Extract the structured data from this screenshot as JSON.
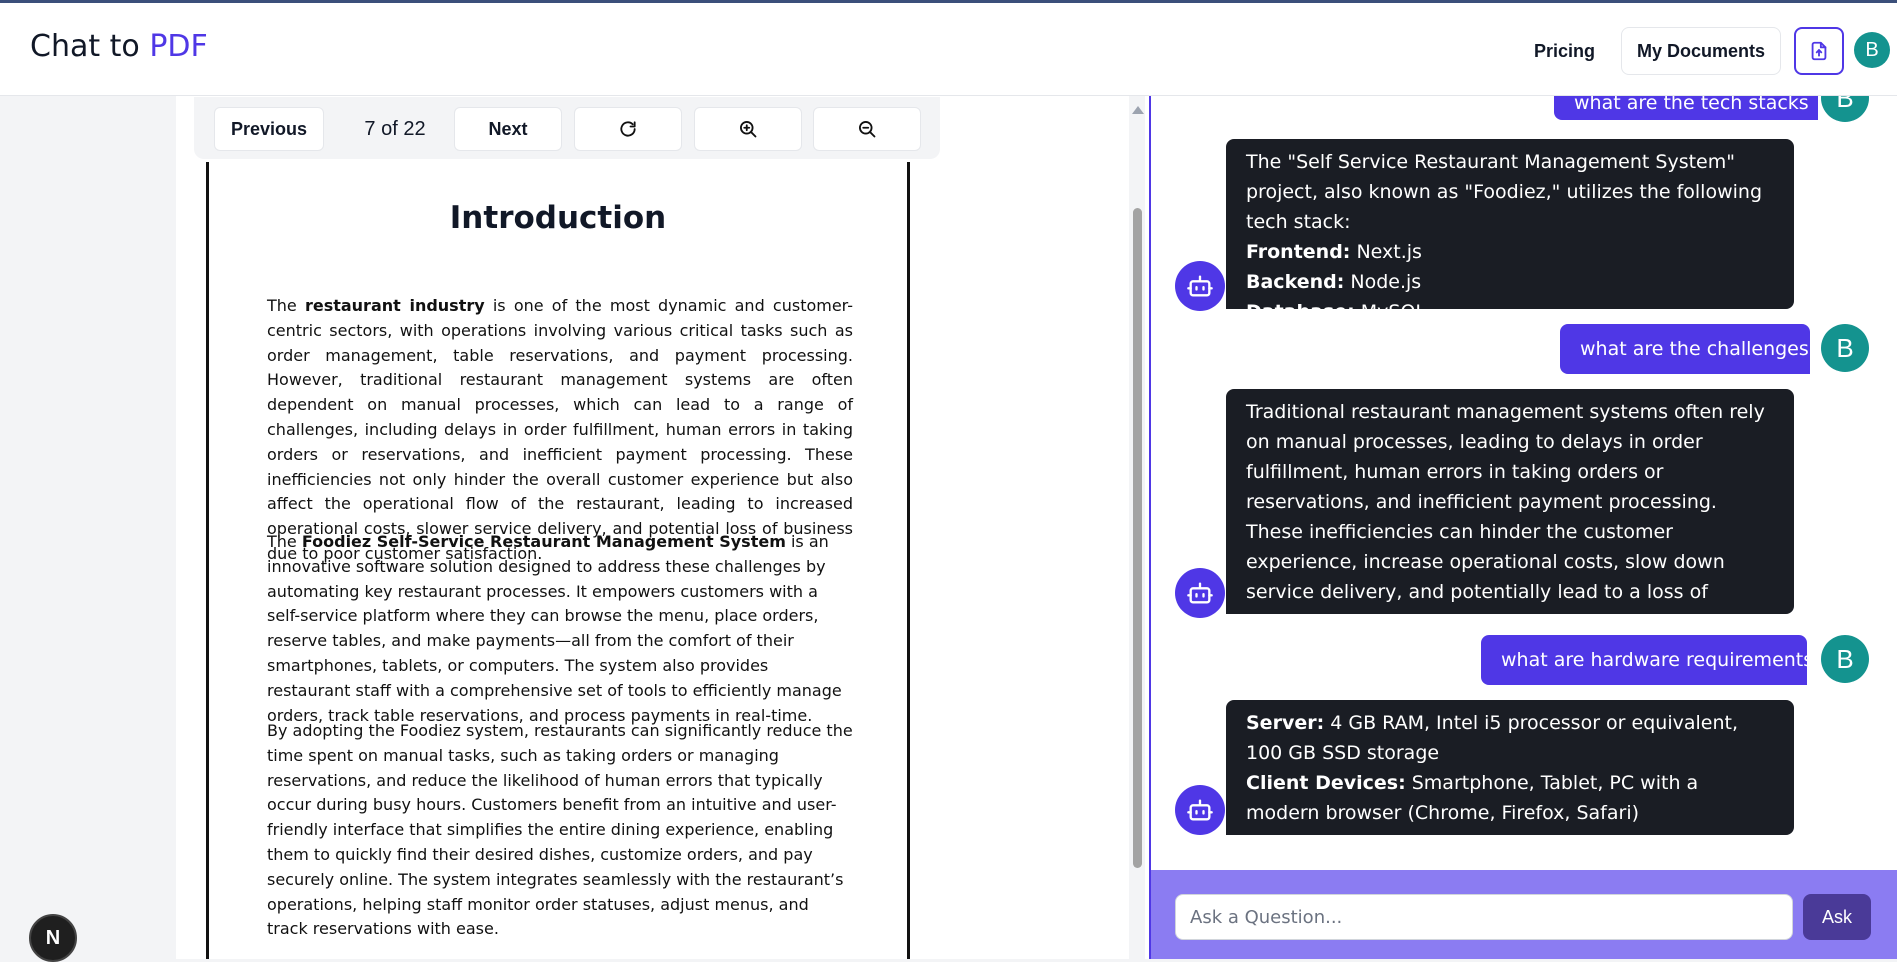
{
  "header": {
    "brand_prefix": "Chat to",
    "brand_accent": "PDF",
    "pricing": "Pricing",
    "my_documents": "My Documents",
    "avatar_initial": "B"
  },
  "toolbar": {
    "previous": "Previous",
    "page_indicator": "7 of 22",
    "next": "Next",
    "refresh_icon": "refresh-icon",
    "zoom_in_icon": "zoom-in-icon",
    "zoom_out_icon": "zoom-out-icon"
  },
  "document": {
    "title": "Introduction",
    "p1_pre": "The ",
    "p1_bold": "restaurant industry",
    "p1_post": " is one of the most dynamic and customer-centric sectors, with operations involving various critical tasks such as order management, table reservations, and payment processing. However, traditional restaurant management systems are often dependent on manual processes, which can lead to a range of challenges, including delays in order fulfillment, human errors in taking orders or reservations, and inefficient payment processing. These inefficiencies not only hinder the overall customer experience but also affect the operational flow of the restaurant, leading to increased operational costs, slower service delivery, and potential loss of business due to poor customer satisfaction.",
    "p2_pre": "The ",
    "p2_bold": "Foodiez Self-Service Restaurant Management System",
    "p2_post": " is an innovative software solution designed to address these challenges by automating key restaurant processes. It empowers customers with a self-service platform where they can browse the menu, place orders, reserve tables, and make payments—all from the comfort of their smartphones, tablets, or computers. The system also provides restaurant staff with a comprehensive set of tools to efficiently manage orders, track table reservations, and process payments in real-time.",
    "p3": "By adopting the Foodiez system, restaurants can significantly reduce the time spent on manual tasks, such as taking orders or managing reservations, and reduce the likelihood of human errors that typically occur during busy hours. Customers benefit from an intuitive and user-friendly interface that simplifies the entire dining experience, enabling them to quickly find their desired dishes, customize orders, and pay securely online. The system integrates seamlessly with the restaurant’s operations, helping staff monitor order statuses, adjust menus, and track reservations with ease."
  },
  "chat": {
    "user_initial": "B",
    "q1": "what are the tech stacks",
    "a1_intro": "The \"Self Service Restaurant Management System\" project, also known as \"Foodiez,\" utilizes the following tech stack:",
    "a1_frontend_label": "Frontend:",
    "a1_frontend_value": " Next.js",
    "a1_backend_label": "Backend:",
    "a1_backend_value": " Node.js",
    "a1_database_label": "Database:",
    "a1_database_value": " MySQL",
    "q2": "what are the challenges",
    "a2": "Traditional restaurant management systems often rely on manual processes, leading to delays in order fulfillment, human errors in taking orders or reservations, and inefficient payment processing. These inefficiencies can hinder the customer experience, increase operational costs, slow down service delivery, and potentially lead to a loss of business due to poor customer satisfaction.",
    "q3": "what are hardware requirements",
    "a3_server_label": "Server:",
    "a3_server_value": " 4 GB RAM, Intel i5 processor or equivalent, 100 GB SSD storage",
    "a3_client_label": "Client Devices:",
    "a3_client_value": " Smartphone, Tablet, PC with a modern browser (Chrome, Firefox, Safari)"
  },
  "ask": {
    "placeholder": "Ask a Question...",
    "button": "Ask"
  },
  "badge": {
    "letter": "N"
  },
  "colors": {
    "accent": "#4f37e6",
    "avatar_teal": "#14938f",
    "bot_bubble": "#1a1d24",
    "ask_bar": "#8b7cf2"
  }
}
